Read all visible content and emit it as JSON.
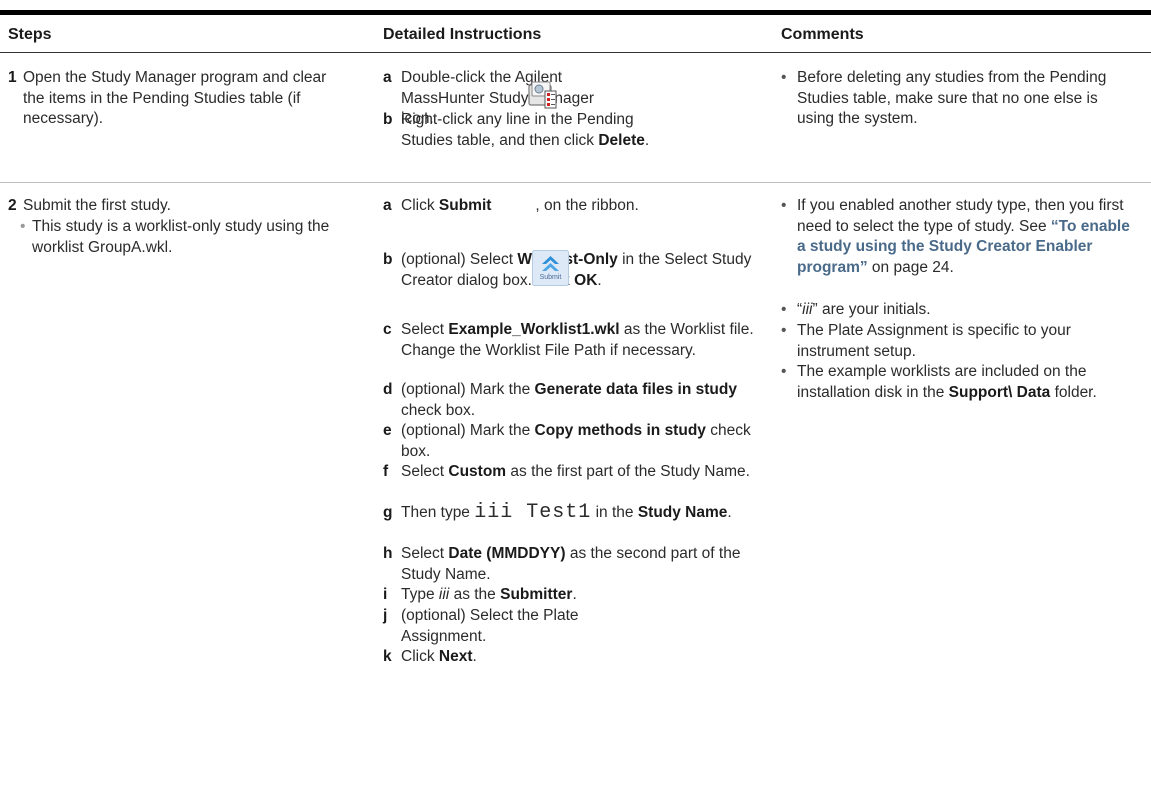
{
  "header": {
    "steps": "Steps",
    "detailed": "Detailed Instructions",
    "comments": "Comments"
  },
  "rows": [
    {
      "num": "1",
      "step": "Open the Study Manager program and clear the items in the Pending Studies table (if necessary).",
      "instructions": {
        "a": {
          "letter": "a",
          "text": "Double-click the Agilent MassHunter Study Manager icon."
        },
        "b": {
          "letter": "b",
          "pre": "Right-click any line in the Pending Studies table, and then click ",
          "bold": "Delete",
          "post": "."
        }
      },
      "comments": [
        "Before deleting any studies from the Pending Studies table, make sure that no one else is using the system."
      ]
    },
    {
      "num": "2",
      "step": "Submit the first study.",
      "substep": "This study is a worklist-only study using the worklist GroupA.wkl.",
      "icon_label": "Submit",
      "instructions": {
        "a": {
          "letter": "a",
          "pre": "Click ",
          "bold": "Submit",
          "mid": " ,",
          "post": ", on the ribbon."
        },
        "b": {
          "letter": "b",
          "pre": "(optional) Select ",
          "bold": "Worklist-Only",
          "mid": " in the Select Study Creator dialog box. Click ",
          "bold2": "OK",
          "post": "."
        },
        "c": {
          "letter": "c",
          "pre": "Select ",
          "bold": "Example_Worklist1.wkl",
          "post": " as the Worklist file. Change the Worklist File Path if necessary."
        },
        "d": {
          "letter": "d",
          "pre": "(optional) Mark the ",
          "bold": "Generate data files in study",
          "post": " check box."
        },
        "e": {
          "letter": "e",
          "pre": "(optional) Mark the ",
          "bold": "Copy methods in study",
          "post": " check box."
        },
        "f": {
          "letter": "f",
          "pre": "Select ",
          "bold": "Custom",
          "post": " as the first part of the Study Name."
        },
        "g": {
          "letter": "g",
          "pre": "Then type ",
          "mono": "iii Test1",
          "mid": " in the ",
          "bold": "Study Name",
          "post": "."
        },
        "h": {
          "letter": "h",
          "pre": "Select ",
          "bold": "Date (MMDDYY)",
          "post": " as the second part of the Study Name."
        },
        "i": {
          "letter": "i",
          "pre": "Type ",
          "ital": "iii",
          "mid": " as the ",
          "bold": "Submitter",
          "post": "."
        },
        "j": {
          "letter": "j",
          "text": "(optional) Select the Plate Assignment."
        },
        "k": {
          "letter": "k",
          "pre": "Click ",
          "bold": "Next",
          "post": "."
        }
      },
      "comments": {
        "c1_pre": "If you enabled another study type, then you first need to select the type of study. See ",
        "c1_link": "“To enable a study using the Study Creator Enabler program”",
        "c1_post": " on page 24.",
        "c2_q1": "“",
        "c2_ital": "iii",
        "c2_post": "” are your initials.",
        "c3": "The Plate Assignment is specific to your instrument setup.",
        "c4_pre": "The example worklists are included on the installation disk in the ",
        "c4_bold": "Support\\ Data",
        "c4_post": " folder."
      }
    }
  ],
  "bullet": "•",
  "colors": {
    "link": "#4a6a8a",
    "rule": "#000000"
  }
}
